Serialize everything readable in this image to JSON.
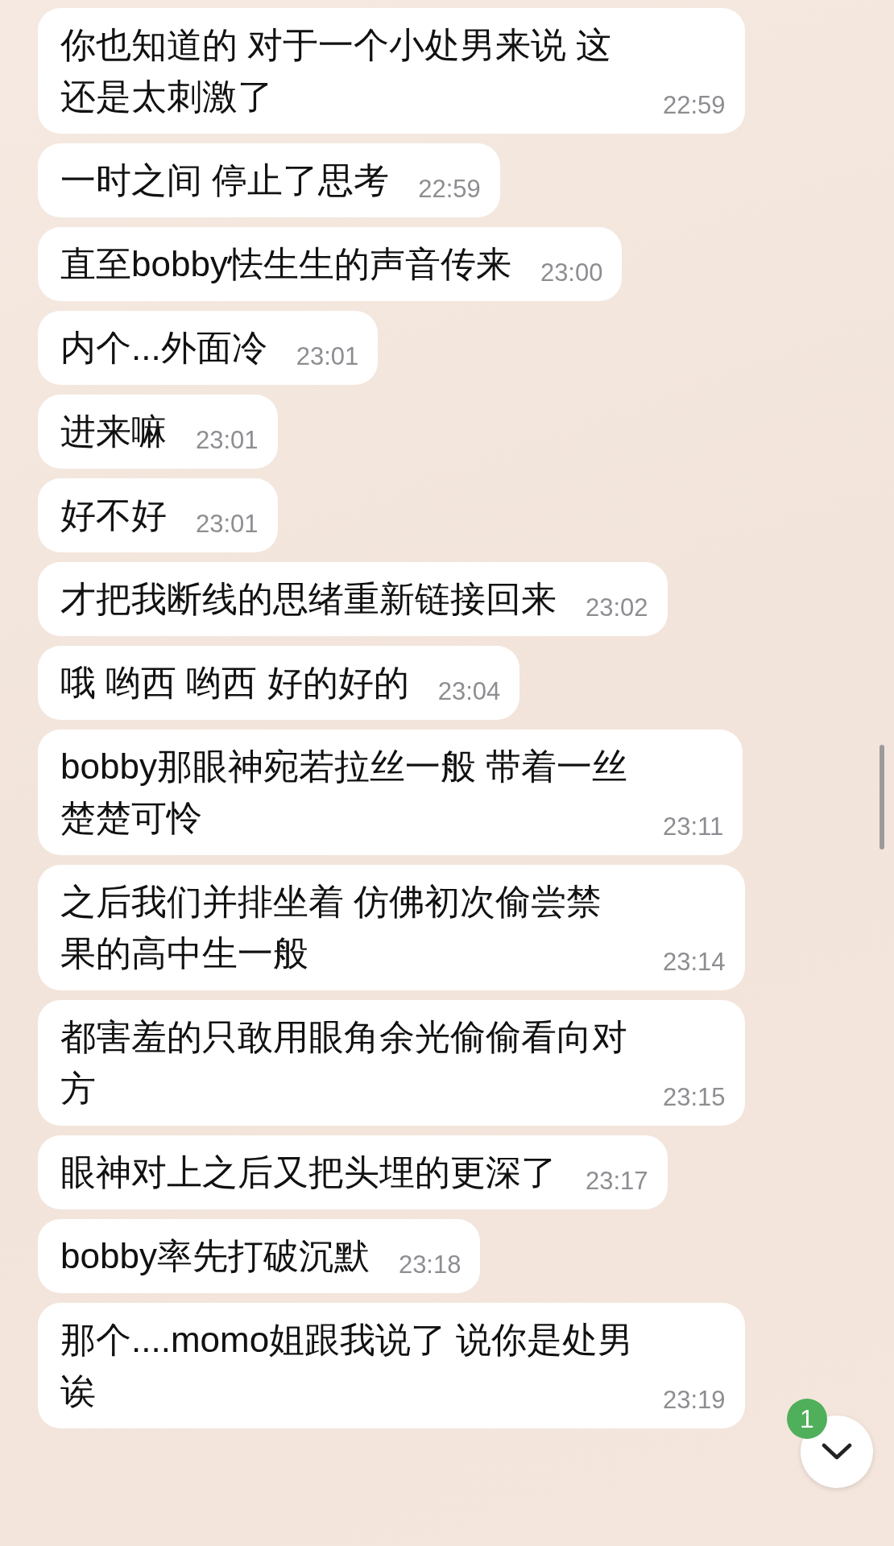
{
  "messages": [
    {
      "text": "你也知道的 对于一个小处男来说 这还是太刺激了",
      "time": "22:59"
    },
    {
      "text": "一时之间 停止了思考",
      "time": "22:59"
    },
    {
      "text": "直至bobby怯生生的声音传来",
      "time": "23:00"
    },
    {
      "text": "内个...外面冷",
      "time": "23:01"
    },
    {
      "text": "进来嘛",
      "time": "23:01"
    },
    {
      "text": "好不好",
      "time": "23:01"
    },
    {
      "text": "才把我断线的思绪重新链接回来",
      "time": "23:02"
    },
    {
      "text": "哦 哟西 哟西 好的好的",
      "time": "23:04"
    },
    {
      "text": "bobby那眼神宛若拉丝一般 带着一丝楚楚可怜",
      "time": "23:11"
    },
    {
      "text": "之后我们并排坐着 仿佛初次偷尝禁果的高中生一般",
      "time": "23:14"
    },
    {
      "text": "都害羞的只敢用眼角余光偷偷看向对方",
      "time": "23:15"
    },
    {
      "text": "眼神对上之后又把头埋的更深了",
      "time": "23:17"
    },
    {
      "text": "bobby率先打破沉默",
      "time": "23:18"
    },
    {
      "text": "那个....momo姐跟我说了 说你是处男诶",
      "time": "23:19"
    }
  ],
  "scroll_button": {
    "badge": "1"
  }
}
